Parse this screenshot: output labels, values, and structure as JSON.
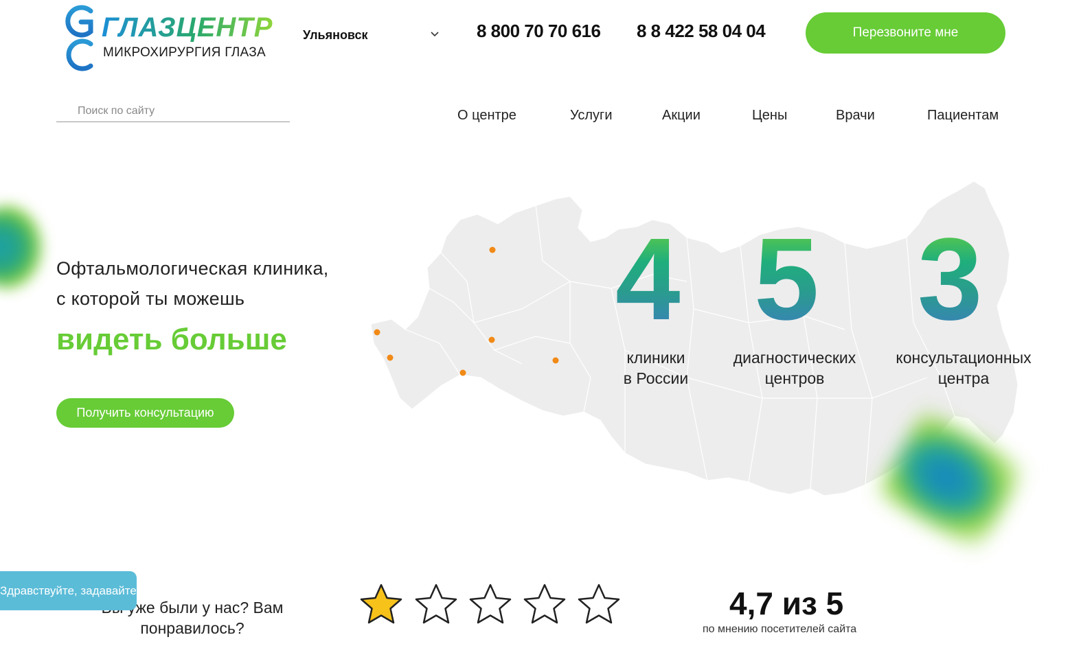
{
  "header": {
    "logo_title": "ГЛАЗЦЕНТР",
    "logo_subtitle": "МИКРОХИРУРГИЯ ГЛАЗА",
    "city": "Ульяновск",
    "phone_1": "8 800 70 70 616",
    "phone_2": "8 8 422 58 04 04",
    "callback_label": "Перезвоните мне"
  },
  "search": {
    "placeholder": "Поиск по сайту"
  },
  "nav": {
    "items": [
      {
        "label": "О центре"
      },
      {
        "label": "Услуги"
      },
      {
        "label": "Акции"
      },
      {
        "label": "Цены"
      },
      {
        "label": "Врачи"
      },
      {
        "label": "Пациентам"
      }
    ]
  },
  "hero": {
    "line_1": "Офтальмологическая клиника,",
    "line_2": "с которой ты можешь",
    "accent": "видеть больше",
    "button_label": "Получить консультацию"
  },
  "stats": [
    {
      "value": "4",
      "label_1": "клиники",
      "label_2": "в России"
    },
    {
      "value": "5",
      "label_1": "диагностических",
      "label_2": "центров"
    },
    {
      "value": "3",
      "label_1": "консультационных",
      "label_2": "центра"
    }
  ],
  "chat": {
    "label": "Здравствуйте, задавайте вопросы!"
  },
  "feedback": {
    "question_1": "Вы уже были у нас? Вам",
    "question_2": "понравилось?",
    "stars_total": 5,
    "stars_selected": 1,
    "rating": "4,7 из 5",
    "rating_caption": "по мнению посетителей сайта"
  },
  "colors": {
    "accent_green": "#67cc36",
    "chat_blue": "#5bbcd8",
    "map_fill": "#ededed",
    "marker_orange": "#f18a16",
    "star_gold": "#f7c21a"
  }
}
